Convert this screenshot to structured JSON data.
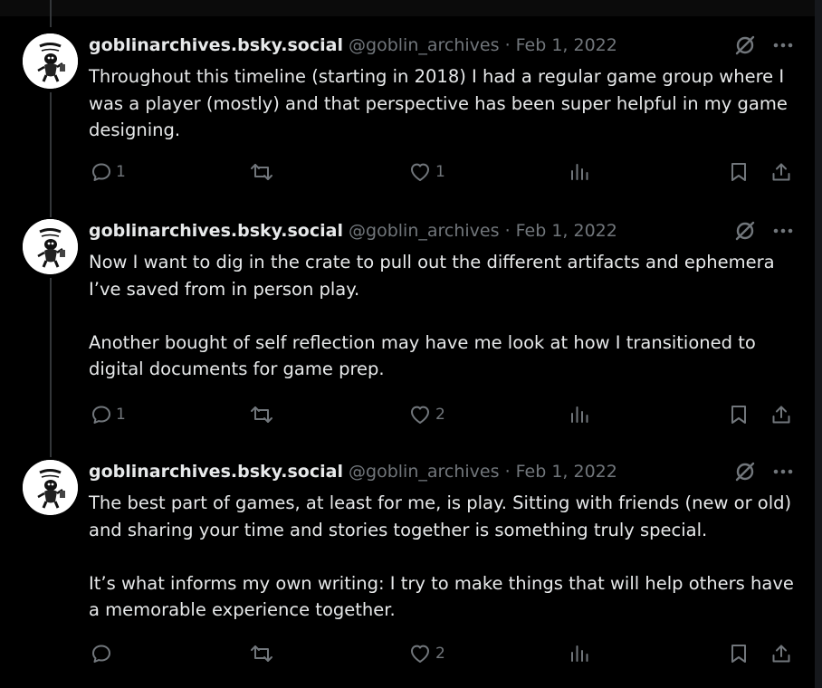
{
  "colors": {
    "background": "#000000",
    "text": "#e7e9ea",
    "muted": "#71767b",
    "thread_line": "#333639"
  },
  "posts": [
    {
      "display_name": "goblinarchives.bsky.social",
      "handle": "@goblin_archives",
      "separator": "·",
      "date": "Feb 1, 2022",
      "paragraphs": [
        "Throughout this timeline (starting in 2018) I had a regular game group where I was a player (mostly) and that perspective has been super helpful in my game designing."
      ],
      "replies": "1",
      "reposts": "",
      "likes": "1"
    },
    {
      "display_name": "goblinarchives.bsky.social",
      "handle": "@goblin_archives",
      "separator": "·",
      "date": "Feb 1, 2022",
      "paragraphs": [
        "Now I want to dig in the crate to pull out the different artifacts and ephemera I’ve saved from in person play.",
        "Another bought of self reflection may have me look at how I transitioned to digital documents for game prep."
      ],
      "replies": "1",
      "reposts": "",
      "likes": "2"
    },
    {
      "display_name": "goblinarchives.bsky.social",
      "handle": "@goblin_archives",
      "separator": "·",
      "date": "Feb 1, 2022",
      "paragraphs": [
        "The best part of games, at least for me, is play. Sitting with friends (new or old) and sharing your time and stories together is something truly special.",
        "It’s what informs my own writing: I try to make things that will help others have a memorable experience together."
      ],
      "replies": "",
      "reposts": "",
      "likes": "2"
    }
  ]
}
